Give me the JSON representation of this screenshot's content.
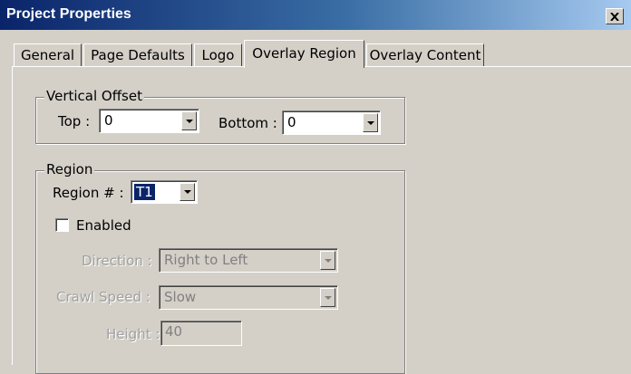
{
  "window": {
    "title": "Project Properties",
    "close_icon": "close-icon",
    "accent_color": "#0a246a"
  },
  "tabs": [
    {
      "label": "General"
    },
    {
      "label": "Page Defaults"
    },
    {
      "label": "Logo"
    },
    {
      "label": "Overlay Region",
      "selected": true
    },
    {
      "label": "Overlay Content"
    }
  ],
  "vertical_offset": {
    "legend": "Vertical Offset",
    "top_label": "Top :",
    "top_value": "0",
    "bottom_label": "Bottom :",
    "bottom_value": "0"
  },
  "region": {
    "legend": "Region",
    "region_label": "Region # :",
    "region_value": "T1",
    "enabled_label": "Enabled",
    "enabled_checked": false,
    "direction_label": "Direction :",
    "direction_value": "Right to Left",
    "crawl_speed_label": "Crawl Speed :",
    "crawl_speed_value": "Slow",
    "height_label": "Height :",
    "height_value": "40"
  }
}
